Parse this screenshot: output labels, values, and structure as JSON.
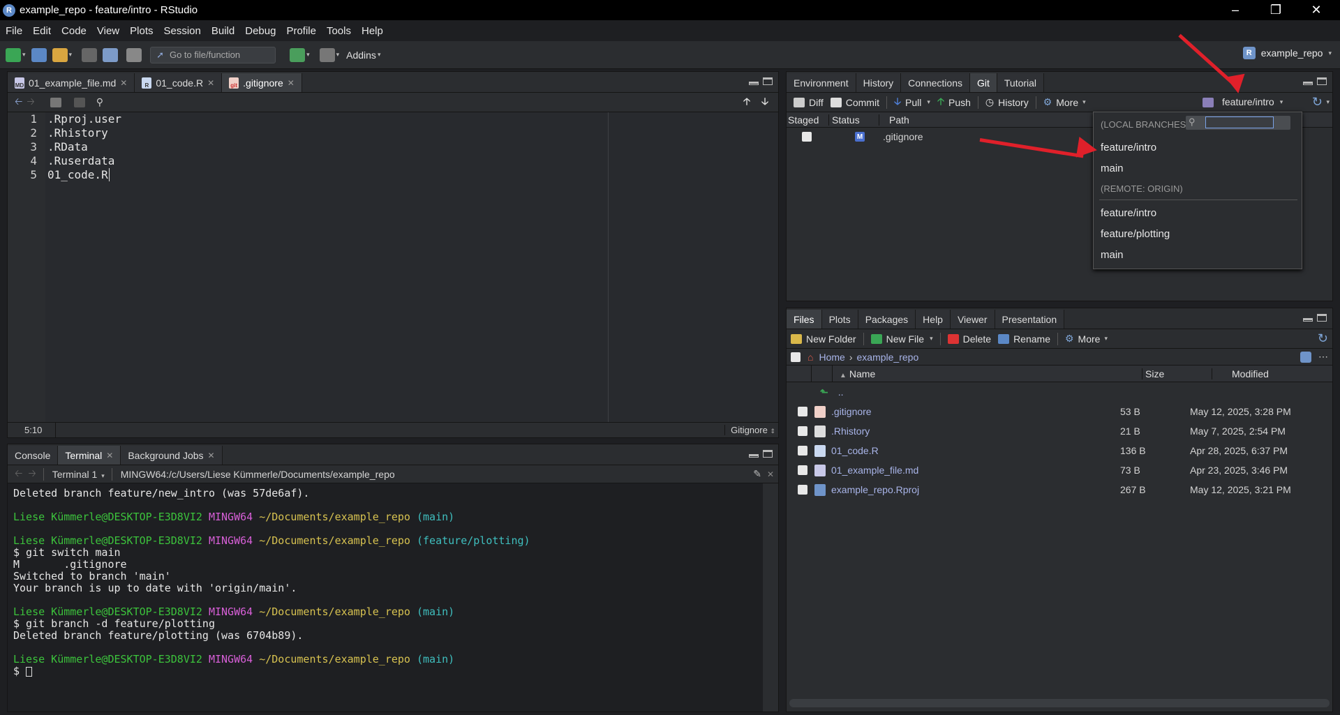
{
  "window": {
    "title": "example_repo - feature/intro - RStudio",
    "r_logo": "R"
  },
  "menu": [
    "File",
    "Edit",
    "Code",
    "View",
    "Plots",
    "Session",
    "Build",
    "Debug",
    "Profile",
    "Tools",
    "Help"
  ],
  "toolbar": {
    "goto_placeholder": "Go to file/function",
    "addins": "Addins",
    "project": "example_repo",
    "project_icon": "R"
  },
  "source": {
    "tabs": [
      {
        "label": "01_example_file.md",
        "icon": "MD"
      },
      {
        "label": "01_code.R",
        "icon": "R"
      },
      {
        "label": ".gitignore",
        "icon": "git"
      }
    ],
    "lines": [
      {
        "n": "1",
        "t": ".Rproj.user"
      },
      {
        "n": "2",
        "t": ".Rhistory"
      },
      {
        "n": "3",
        "t": ".RData"
      },
      {
        "n": "4",
        "t": ".Ruserdata"
      },
      {
        "n": "5",
        "t": "01_code.R"
      }
    ],
    "status_pos": "5:10",
    "status_mode": "Gitignore"
  },
  "console": {
    "tabs": [
      "Console",
      "Terminal",
      "Background Jobs"
    ],
    "terminal_name": "Terminal 1",
    "terminal_path": "MINGW64:/c/Users/Liese Kümmerle/Documents/example_repo",
    "lines": [
      {
        "parts": [
          {
            "t": "Deleted branch feature/new_intro (was 57de6af).",
            "c": ""
          }
        ]
      },
      {
        "parts": []
      },
      {
        "parts": [
          {
            "t": "Liese Kümmerle@DESKTOP-E3D8VI2 ",
            "c": "g"
          },
          {
            "t": "MINGW64 ",
            "c": "m"
          },
          {
            "t": "~/Documents/example_repo ",
            "c": "y"
          },
          {
            "t": "(main)",
            "c": "c"
          }
        ]
      },
      {
        "parts": []
      },
      {
        "parts": [
          {
            "t": "Liese Kümmerle@DESKTOP-E3D8VI2 ",
            "c": "g"
          },
          {
            "t": "MINGW64 ",
            "c": "m"
          },
          {
            "t": "~/Documents/example_repo ",
            "c": "y"
          },
          {
            "t": "(feature/plotting)",
            "c": "c"
          }
        ]
      },
      {
        "parts": [
          {
            "t": "$ git switch main",
            "c": ""
          }
        ]
      },
      {
        "parts": [
          {
            "t": "M       .gitignore",
            "c": ""
          }
        ]
      },
      {
        "parts": [
          {
            "t": "Switched to branch 'main'",
            "c": ""
          }
        ]
      },
      {
        "parts": [
          {
            "t": "Your branch is up to date with 'origin/main'.",
            "c": ""
          }
        ]
      },
      {
        "parts": []
      },
      {
        "parts": [
          {
            "t": "Liese Kümmerle@DESKTOP-E3D8VI2 ",
            "c": "g"
          },
          {
            "t": "MINGW64 ",
            "c": "m"
          },
          {
            "t": "~/Documents/example_repo ",
            "c": "y"
          },
          {
            "t": "(main)",
            "c": "c"
          }
        ]
      },
      {
        "parts": [
          {
            "t": "$ git branch -d feature/plotting",
            "c": ""
          }
        ]
      },
      {
        "parts": [
          {
            "t": "Deleted branch feature/plotting (was 6704b89).",
            "c": ""
          }
        ]
      },
      {
        "parts": []
      },
      {
        "parts": [
          {
            "t": "Liese Kümmerle@DESKTOP-E3D8VI2 ",
            "c": "g"
          },
          {
            "t": "MINGW64 ",
            "c": "m"
          },
          {
            "t": "~/Documents/example_repo ",
            "c": "y"
          },
          {
            "t": "(main)",
            "c": "c"
          }
        ]
      },
      {
        "parts": [
          {
            "t": "$ ",
            "c": ""
          }
        ]
      }
    ]
  },
  "envpane": {
    "tabs": [
      "Environment",
      "History",
      "Connections",
      "Git",
      "Tutorial"
    ],
    "buttons": {
      "diff": "Diff",
      "commit": "Commit",
      "pull": "Pull",
      "push": "Push",
      "history": "History",
      "more": "More"
    },
    "branch": "feature/intro",
    "headers": {
      "staged": "Staged",
      "status": "Status",
      "path": "Path"
    },
    "rows": [
      {
        "status": "M",
        "path": ".gitignore"
      }
    ]
  },
  "branch_menu": {
    "local_header": "(LOCAL BRANCHES)",
    "local": [
      "feature/intro",
      "main"
    ],
    "remote_header": "(REMOTE: ORIGIN)",
    "remote": [
      "feature/intro",
      "feature/plotting",
      "main"
    ]
  },
  "files": {
    "tabs": [
      "Files",
      "Plots",
      "Packages",
      "Help",
      "Viewer",
      "Presentation"
    ],
    "buttons": {
      "new_folder": "New Folder",
      "new_file": "New File",
      "delete": "Delete",
      "rename": "Rename",
      "more": "More"
    },
    "breadcrumb": {
      "home": "Home",
      "folder": "example_repo"
    },
    "headers": {
      "name": "Name",
      "size": "Size",
      "modified": "Modified"
    },
    "up": "..",
    "rows": [
      {
        "name": ".gitignore",
        "size": "53 B",
        "modified": "May 12, 2025, 3:28 PM",
        "icon": "git"
      },
      {
        "name": ".Rhistory",
        "size": "21 B",
        "modified": "May 7, 2025, 2:54 PM",
        "icon": "hist"
      },
      {
        "name": "01_code.R",
        "size": "136 B",
        "modified": "Apr 28, 2025, 6:37 PM",
        "icon": "R"
      },
      {
        "name": "01_example_file.md",
        "size": "73 B",
        "modified": "Apr 23, 2025, 3:46 PM",
        "icon": "MD"
      },
      {
        "name": "example_repo.Rproj",
        "size": "267 B",
        "modified": "May 12, 2025, 3:21 PM",
        "icon": "Rproj"
      }
    ]
  },
  "colors": {
    "accent": "#e0202a",
    "r_blue": "#5b88c6"
  }
}
